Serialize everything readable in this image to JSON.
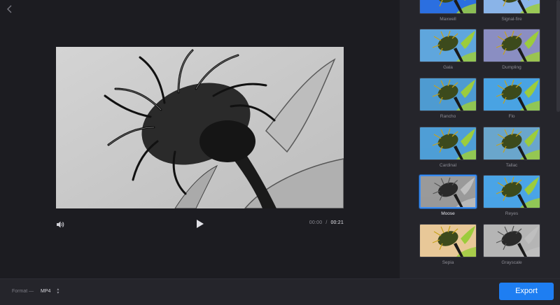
{
  "player": {
    "current_time": "00:00",
    "separator": "/",
    "total_time": "00:21"
  },
  "filters": [
    {
      "name": "Maxwell",
      "tint": "#2b6fe0",
      "selected": false
    },
    {
      "name": "Signal-fire",
      "tint": "#8ab4e8",
      "selected": false
    },
    {
      "name": "Gala",
      "tint": "#5fa6dd",
      "selected": false
    },
    {
      "name": "Dumpling",
      "tint": "#8b8ec2",
      "selected": false
    },
    {
      "name": "Rancho",
      "tint": "#4e9bd1",
      "selected": false
    },
    {
      "name": "Flo",
      "tint": "#49a3e3",
      "selected": false
    },
    {
      "name": "Cardinal",
      "tint": "#4f9ed6",
      "selected": false
    },
    {
      "name": "Tallac",
      "tint": "#6aa6cc",
      "selected": false
    },
    {
      "name": "Moose",
      "tint": "#9a9a9a",
      "selected": true
    },
    {
      "name": "Reyes",
      "tint": "#4aa4e6",
      "selected": false
    },
    {
      "name": "Sepia",
      "tint": "#e8c898",
      "selected": false
    },
    {
      "name": "Grayscale",
      "tint": "#b5b5b5",
      "selected": false
    }
  ],
  "footer": {
    "format_label": "Format —",
    "format_value": "MP4",
    "export_label": "Export"
  },
  "colors": {
    "accent": "#1e7ef2",
    "background": "#1c1c21",
    "sidebar": "#25252b"
  }
}
